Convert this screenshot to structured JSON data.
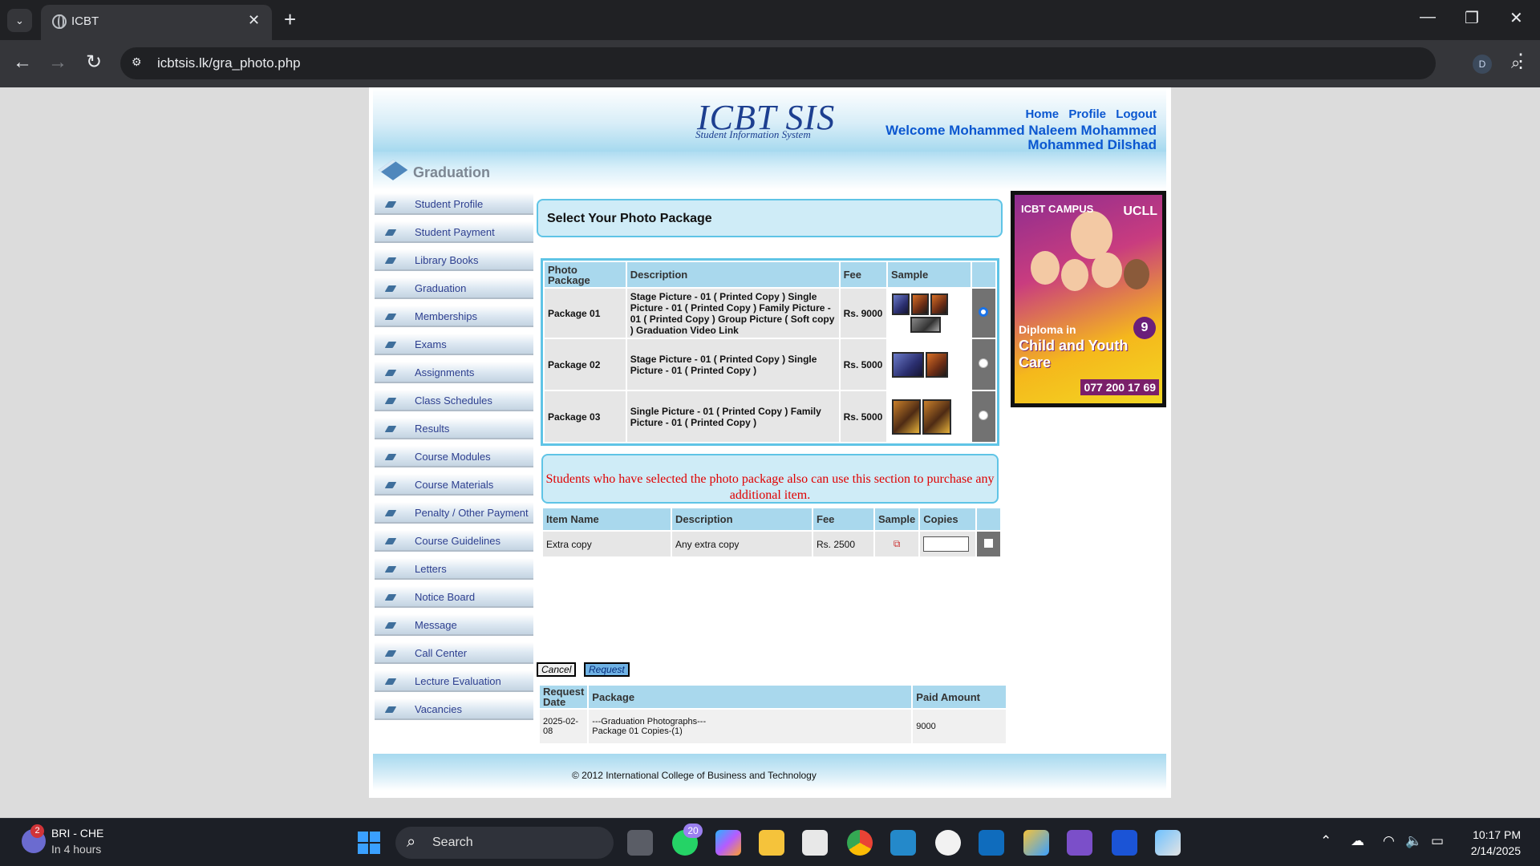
{
  "browser": {
    "tab_title": "ICBT",
    "url": "icbtsis.lk/gra_photo.php",
    "profile_initial": "D"
  },
  "header": {
    "logo": "ICBT SIS",
    "logo_sub": "Student Information System",
    "links": {
      "home": "Home",
      "profile": "Profile",
      "logout": "Logout"
    },
    "welcome": "Welcome Mohammed Naleem Mohammed Mohammed Dilshad"
  },
  "section": {
    "title": "Graduation"
  },
  "sidebar": {
    "items": [
      "Student Profile",
      "Student Payment",
      "Library Books",
      "Graduation",
      "Memberships",
      "Exams",
      "Assignments",
      "Class Schedules",
      "Results",
      "Course Modules",
      "Course Materials",
      "Penalty / Other Payment",
      "Course Guidelines",
      "Letters",
      "Notice Board",
      "Message",
      "Call Center",
      "Lecture Evaluation",
      "Vacancies"
    ]
  },
  "main": {
    "title": "Select Your Photo Package",
    "package_headers": {
      "package": "Photo Package",
      "description": "Description",
      "fee": "Fee",
      "sample": "Sample"
    },
    "packages": [
      {
        "name": "Package 01",
        "description": "Stage Picture - 01 ( Printed Copy ) Single Picture - 01 ( Printed Copy ) Family Picture - 01 ( Printed Copy ) Group Picture ( Soft copy ) Graduation Video Link",
        "fee": "Rs. 9000",
        "selected": true
      },
      {
        "name": "Package 02",
        "description": "Stage Picture - 01 ( Printed Copy ) Single Picture - 01 ( Printed Copy )",
        "fee": "Rs. 5000",
        "selected": false
      },
      {
        "name": "Package 03",
        "description": "Single Picture - 01 ( Printed Copy ) Family Picture - 01 ( Printed Copy )",
        "fee": "Rs. 5000",
        "selected": false
      }
    ],
    "notice": "Students who have selected the photo package also can use this section to purchase any additional item.",
    "extra_headers": {
      "item": "Item Name",
      "description": "Description",
      "fee": "Fee",
      "sample": "Sample",
      "copies": "Copies"
    },
    "extra_items": [
      {
        "name": "Extra copy",
        "description": "Any extra copy",
        "fee": "Rs. 2500",
        "copies": ""
      }
    ],
    "buttons": {
      "cancel": "Cancel",
      "request": "Request"
    },
    "request_headers": {
      "date": "Request Date",
      "package": "Package",
      "paid": "Paid Amount"
    },
    "requests": [
      {
        "date": "2025-02-08",
        "package_line1": "---Graduation Photographs---",
        "package_line2": "Package 01 Copies-(1)",
        "paid": "9000"
      }
    ]
  },
  "ad": {
    "brand": "ICBT CAMPUS",
    "partner": "UCLL",
    "line1": "Diploma in",
    "line2": "Child and Youth Care",
    "badge": "9",
    "phone": "077 200 17 69"
  },
  "footer": {
    "text": "© 2012 International College of Business and Technology"
  },
  "taskbar": {
    "weather_badge": "2",
    "weather_title": "BRI - CHE",
    "weather_sub": "In 4 hours",
    "search": "Search",
    "whatsapp_badge": "20",
    "time": "10:17 PM",
    "date": "2/14/2025"
  }
}
